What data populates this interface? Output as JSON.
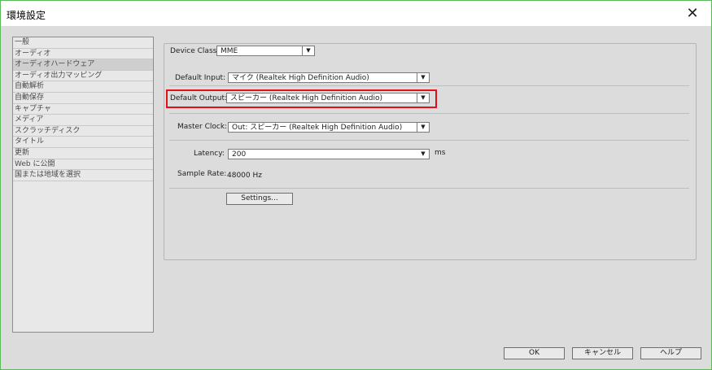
{
  "window": {
    "title": "環境設定",
    "close_glyph": "✕"
  },
  "sidebar": {
    "items": [
      {
        "label": "一般"
      },
      {
        "label": "オーディオ"
      },
      {
        "label": "オーディオハードウェア",
        "selected": true
      },
      {
        "label": "オーディオ出力マッピング"
      },
      {
        "label": "自動解析"
      },
      {
        "label": "自動保存"
      },
      {
        "label": "キャプチャ"
      },
      {
        "label": "メディア"
      },
      {
        "label": "スクラッチディスク"
      },
      {
        "label": "タイトル"
      },
      {
        "label": "更新"
      },
      {
        "label": "Web に公開"
      },
      {
        "label": "国または地域を選択"
      }
    ]
  },
  "device_class": {
    "label": "Device Class:",
    "value": "MME"
  },
  "default_input": {
    "label": "Default Input:",
    "value": "マイク (Realtek High Definition Audio)"
  },
  "default_output": {
    "label": "Default Output:",
    "value": "スピーカー (Realtek High Definition Audio)"
  },
  "master_clock": {
    "label": "Master Clock:",
    "value": "Out: スピーカー (Realtek High Definition Audio)"
  },
  "latency": {
    "label": "Latency:",
    "value": "200",
    "unit": "ms"
  },
  "sample_rate": {
    "label": "Sample Rate:",
    "value": "48000 Hz"
  },
  "settings_button": {
    "label": "Settings..."
  },
  "footer": {
    "ok": "OK",
    "cancel": "キャンセル",
    "help": "ヘルプ"
  },
  "colors": {
    "highlight": "#e3101a",
    "window_border": "#5bb85b",
    "background": "#dcdcdc"
  }
}
